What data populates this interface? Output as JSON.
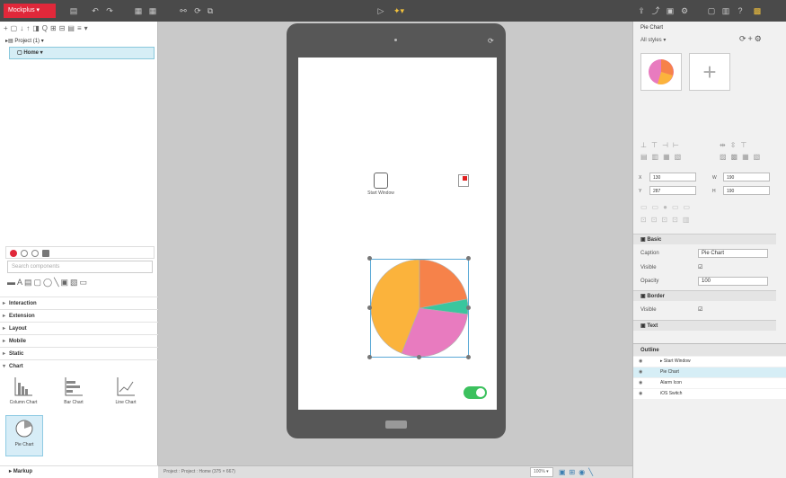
{
  "app": {
    "logo_label": "Mockplus",
    "accent_color": "#e0283a",
    "toolbar_left_icons": [
      "pages-icon",
      "undo-icon",
      "redo-icon",
      "align-icon",
      "rotate-icon",
      "link-icon"
    ],
    "toolbar_center_icons": [
      "play-icon",
      "preview-icon"
    ],
    "toolbar_right_icons": [
      "share-icon",
      "export-icon",
      "settings-icon",
      "window-icon",
      "user-icon"
    ]
  },
  "project_tree": {
    "project_label": "Project (1)",
    "page_label": "Home"
  },
  "library": {
    "search_placeholder": "Search components",
    "categories": [
      {
        "label": "Interaction"
      },
      {
        "label": "Extension"
      },
      {
        "label": "Layout"
      },
      {
        "label": "Mobile"
      },
      {
        "label": "Static"
      },
      {
        "label": "Chart"
      }
    ],
    "chart_items": [
      {
        "label": "Column Chart"
      },
      {
        "label": "Bar Chart"
      },
      {
        "label": "Line Chart"
      },
      {
        "label": "Pie Chart"
      }
    ],
    "bottom_category": "Markup"
  },
  "canvas": {
    "start_window_label": "Start Window",
    "pie_colors": [
      "#fbb33c",
      "#f6824a",
      "#3ac69e",
      "#e87bbf"
    ],
    "pie_values": [
      44,
      22,
      5,
      29
    ],
    "toggle_color": "#3cc15e"
  },
  "right_panel": {
    "title": "Pie Chart",
    "styles_label": "All styles",
    "x_label": "X",
    "x_value": "130",
    "y_label": "Y",
    "y_value": "287",
    "w_label": "W",
    "w_value": "190",
    "h_label": "H",
    "h_value": "190",
    "sections": {
      "basic": "Basic",
      "border": "Border",
      "text": "Text"
    },
    "props": {
      "caption_label": "Caption",
      "caption_value": "Pie Chart",
      "visible_label": "Visible",
      "opacity_label": "Opacity",
      "opacity_value": "100",
      "border_visible_label": "Visible"
    },
    "outline": {
      "header": "Outline",
      "items": [
        {
          "label": "Start Window"
        },
        {
          "label": "Pie Chart"
        },
        {
          "label": "Alarm Icon"
        },
        {
          "label": "iOS Switch"
        }
      ]
    }
  },
  "status": {
    "path": "Project : Project : Home (375 × 667)",
    "zoom": "100%"
  }
}
